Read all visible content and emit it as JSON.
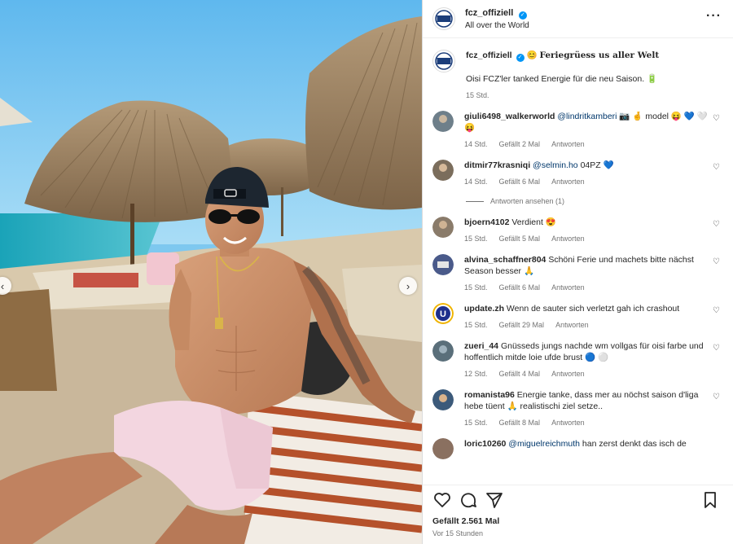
{
  "account": {
    "username": "fcz_offiziell",
    "subtitle": "All over the World",
    "avatar_text": "FCZ"
  },
  "caption": {
    "username": "fcz_offiziell",
    "title": "Feriegrüess us aller Welt",
    "text": "Oisi FCZ'ler tanked Energie für die neu Saison.",
    "time": "15 Std."
  },
  "comments": [
    {
      "user": "giuli6498_walkerworld",
      "mention": "@lindritkamberi",
      "text": "📷 🤞 model 😝 💙 🤍",
      "text2": "😝",
      "time": "14 Std.",
      "likes": "Gefällt 2 Mal",
      "reply": "Antworten",
      "avatar_color": "#6e7f8a"
    },
    {
      "user": "ditmir77krasniqi",
      "mention": "@selmin.ho",
      "text": "04PZ 💙",
      "time": "14 Std.",
      "likes": "Gefällt 6 Mal",
      "reply": "Antworten",
      "avatar_color": "#7b6d5c"
    },
    {
      "user": "bjoern4102",
      "mention": "",
      "text": "Verdient 😍",
      "time": "15 Std.",
      "likes": "Gefällt 5 Mal",
      "reply": "Antworten",
      "avatar_color": "#8a7b6a"
    },
    {
      "user": "alvina_schaffner804",
      "mention": "",
      "text": "Schöni Ferie und machets bitte nächst Season besser 🙏",
      "time": "15 Std.",
      "likes": "Gefällt 6 Mal",
      "reply": "Antworten",
      "avatar_color": "#4a5a8a"
    },
    {
      "user": "update.zh",
      "mention": "",
      "text": "Wenn de sauter sich verletzt gah ich crashout",
      "time": "15 Std.",
      "likes": "Gefällt 29 Mal",
      "reply": "Antworten",
      "avatar_color": "#1e2f8c"
    },
    {
      "user": "zueri_44",
      "mention": "",
      "text": "Gnüsseds jungs nachde wm vollgas für oisi farbe und hoffentlich mitde loie ufde brust 🔵 ⚪",
      "time": "12 Std.",
      "likes": "Gefällt 4 Mal",
      "reply": "Antworten",
      "avatar_color": "#5a6f7a"
    },
    {
      "user": "romanista96",
      "mention": "",
      "text": "Energie tanke, dass mer au nöchst saison d'liga hebe tüent 🙏 realistischi ziel setze..",
      "time": "15 Std.",
      "likes": "Gefällt 8 Mal",
      "reply": "Antworten",
      "avatar_color": "#3c5a7a"
    },
    {
      "user": "loric10260",
      "mention": "@miguelreichmuth",
      "text": "han zerst denkt das isch de",
      "time": "",
      "likes": "",
      "reply": "",
      "avatar_color": "#8a7060"
    }
  ],
  "view_replies": "Antworten ansehen (1)",
  "likes_total": "Gefällt 2.561 Mal",
  "posted": "Vor 15 Stunden",
  "icons": [
    "more-icon",
    "heart-icon",
    "comment-icon",
    "share-icon",
    "bookmark-icon",
    "verified-icon",
    "chevron-left-icon",
    "chevron-right-icon"
  ]
}
